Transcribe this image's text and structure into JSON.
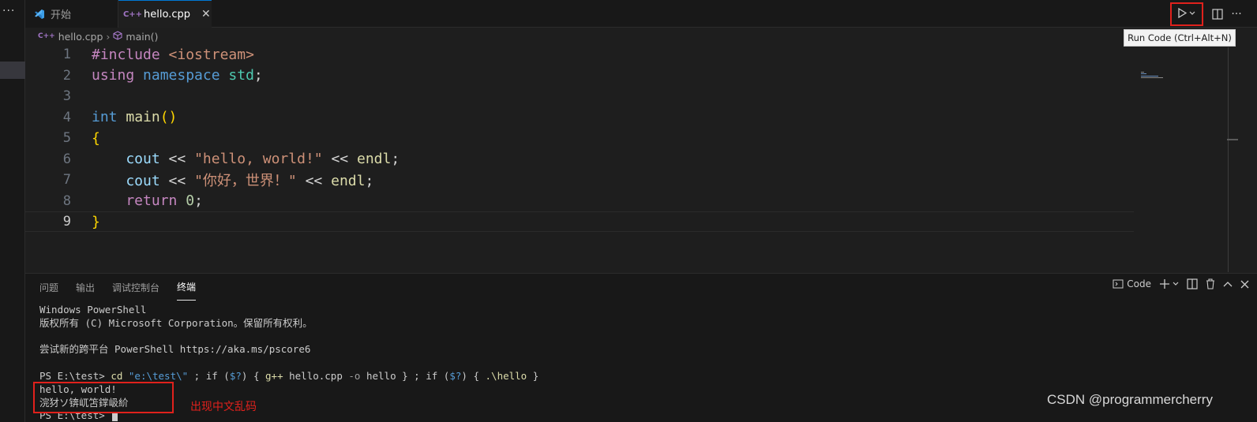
{
  "activity": {
    "more": "···"
  },
  "tabs": [
    {
      "label": "开始",
      "active": false
    },
    {
      "label": "hello.cpp",
      "active": true,
      "close": "✕"
    }
  ],
  "toolbar": {
    "more": "···"
  },
  "tooltip": "Run Code (Ctrl+Alt+N)",
  "breadcrumb": {
    "file": "hello.cpp",
    "symbol": "main()"
  },
  "editor": {
    "line_numbers": [
      "1",
      "2",
      "3",
      "4",
      "5",
      "6",
      "7",
      "8",
      "9"
    ],
    "lines": [
      [
        {
          "t": "#include ",
          "c": "k-pre"
        },
        {
          "t": "<iostream>",
          "c": "k-inc"
        }
      ],
      [
        {
          "t": "using ",
          "c": "k-ctl"
        },
        {
          "t": "namespace ",
          "c": "k-kw"
        },
        {
          "t": "std",
          "c": "k-ns"
        },
        {
          "t": ";",
          "c": "k-op"
        }
      ],
      [],
      [
        {
          "t": "int ",
          "c": "k-kw"
        },
        {
          "t": "main",
          "c": "k-fn"
        },
        {
          "t": "()",
          "c": "k-br"
        }
      ],
      [
        {
          "t": "{",
          "c": "k-br"
        }
      ],
      [
        {
          "t": "    cout ",
          "c": "k-var"
        },
        {
          "t": "<< ",
          "c": "k-op"
        },
        {
          "t": "\"hello, world!\"",
          "c": "k-str"
        },
        {
          "t": " << ",
          "c": "k-op"
        },
        {
          "t": "endl",
          "c": "k-endl"
        },
        {
          "t": ";",
          "c": "k-op"
        }
      ],
      [
        {
          "t": "    cout ",
          "c": "k-var"
        },
        {
          "t": "<< ",
          "c": "k-op"
        },
        {
          "t": "\"你好，世界！\"",
          "c": "k-str"
        },
        {
          "t": " << ",
          "c": "k-op"
        },
        {
          "t": "endl",
          "c": "k-endl"
        },
        {
          "t": ";",
          "c": "k-op"
        }
      ],
      [
        {
          "t": "    return ",
          "c": "k-ctl"
        },
        {
          "t": "0",
          "c": "k-num"
        },
        {
          "t": ";",
          "c": "k-op"
        }
      ],
      [
        {
          "t": "}",
          "c": "k-br"
        }
      ]
    ],
    "current_line": 9
  },
  "panel": {
    "tabs": [
      "问题",
      "输出",
      "调试控制台",
      "终端"
    ],
    "active_tab": "终端",
    "terminal_name": "Code",
    "terminal": [
      "Windows PowerShell",
      "版权所有 (C) Microsoft Corporation。保留所有权利。",
      "",
      "尝试新的跨平台 PowerShell https://aka.ms/pscore6",
      "",
      "PS E:\\test> ",
      "hello, world!",
      "浣犲ソ锛屼笘鐣岋紒"
    ],
    "command": {
      "prefix": "cd ",
      "path": "\"e:\\test\\\"",
      "rest1": " ; if (",
      "var1": "$?",
      "rest2": ") { ",
      "gpp": "g++",
      "rest3": " hello.cpp ",
      "flag": "-o",
      "rest4": " hello } ; if (",
      "var2": "$?",
      "rest5": ") { ",
      "run": ".\\hello",
      "rest6": " }"
    },
    "prompt_partial": "PS E:\\test> "
  },
  "annotation": "出现中文乱码",
  "watermark": "CSDN @programmercherry",
  "colors": {
    "accent": "#0078d4",
    "highlight_box": "#e0211c"
  }
}
